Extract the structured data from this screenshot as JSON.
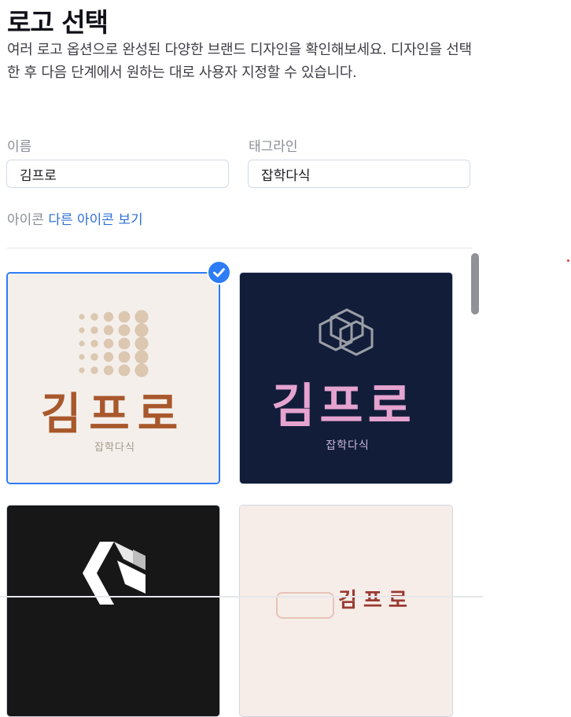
{
  "header": {
    "title": "로고 선택",
    "subtitle": "여러 로고 옵션으로 완성된 다양한 브랜드 디자인을 확인해보세요. 디자인을 선택한 후 다음 단계에서 원하는 대로 사용자 지정할 수 있습니다."
  },
  "form": {
    "name": {
      "label": "이름",
      "value": "김프로"
    },
    "tagline": {
      "label": "태그라인",
      "value": "잡학다식"
    }
  },
  "icon_row": {
    "label": "아이콘",
    "link": "다른 아이콘 보기"
  },
  "logos": [
    {
      "brand": "김프로",
      "tagline": "잡학다식",
      "selected": true,
      "bg": "#f4efeb",
      "brand_color": "#a8582c",
      "tagline_color": "#a39a8e",
      "icon": "dot-grid-icon"
    },
    {
      "brand": "김프로",
      "tagline": "잡학다식",
      "selected": false,
      "bg": "#121d3a",
      "brand_color": "#e5a3d0",
      "tagline_color": "#c9b7d6",
      "icon": "cube-outline-icon"
    },
    {
      "brand": "",
      "tagline": "",
      "selected": false,
      "bg": "#171717",
      "brand_color": "#ffffff",
      "tagline_color": "#ffffff",
      "icon": "chevron-cube-icon"
    },
    {
      "brand": "김프로",
      "tagline": "",
      "selected": false,
      "bg": "#f6ede8",
      "brand_color": "#9a3a32",
      "tagline_color": "#9a3a32",
      "icon": "rounded-badge-icon"
    }
  ]
}
